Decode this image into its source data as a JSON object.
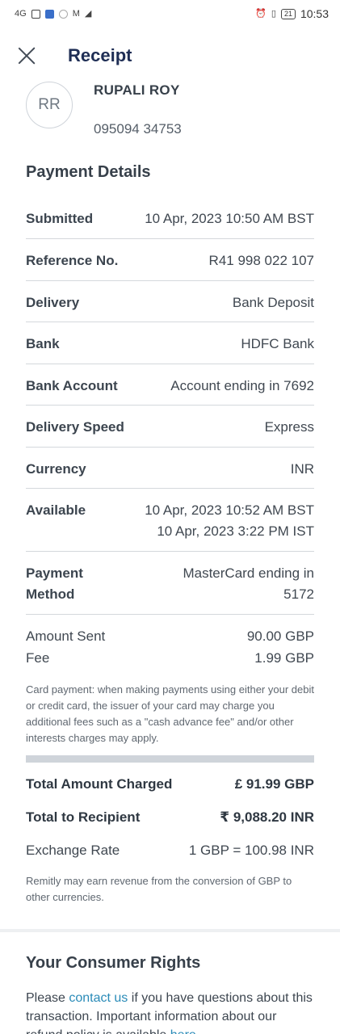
{
  "status_bar": {
    "network": "4G",
    "time": "10:53",
    "battery": "21"
  },
  "header": {
    "title": "Receipt"
  },
  "recipient": {
    "initials": "RR",
    "name": "RUPALI ROY",
    "phone": "095094 34753"
  },
  "payment_details": {
    "title": "Payment Details",
    "rows": [
      {
        "label": "Submitted",
        "value": [
          "10 Apr, 2023 10:50 AM BST"
        ]
      },
      {
        "label": "Reference No.",
        "value": [
          "R41 998 022 107"
        ]
      },
      {
        "label": "Delivery",
        "value": [
          "Bank Deposit"
        ]
      },
      {
        "label": "Bank",
        "value": [
          "HDFC Bank"
        ]
      },
      {
        "label": "Bank Account",
        "value": [
          "Account ending in 7692"
        ]
      },
      {
        "label": "Delivery Speed",
        "value": [
          "Express"
        ]
      },
      {
        "label": "Currency",
        "value": [
          "INR"
        ]
      },
      {
        "label": "Available",
        "value": [
          "10 Apr, 2023 10:52 AM BST",
          "10 Apr, 2023 3:22 PM IST"
        ]
      },
      {
        "label": [
          "Payment",
          "Method"
        ],
        "value": [
          "MasterCard ending in",
          "5172"
        ]
      }
    ]
  },
  "amounts": {
    "sent_label": "Amount Sent",
    "sent_value": "90.00 GBP",
    "fee_label": "Fee",
    "fee_value": "1.99 GBP",
    "card_note": "Card payment: when making payments using either your debit or credit card, the issuer of your card may charge you additional fees such as a \"cash advance fee\" and/or other interests charges may apply."
  },
  "totals": {
    "charged_label": "Total Amount Charged",
    "charged_value": "£ 91.99 GBP",
    "recipient_label": "Total to Recipient",
    "recipient_value": "₹ 9,088.20 INR",
    "rate_label": "Exchange Rate",
    "rate_value": "1 GBP = 100.98 INR",
    "revenue_note": "Remitly may earn revenue from the conversion of GBP to other currencies."
  },
  "consumer_rights": {
    "title": "Your Consumer Rights",
    "text_before": "Please ",
    "contact_link": "contact us",
    "text_middle": " if you have questions about this transaction. Important information about our refund policy is available ",
    "here_link": "here"
  }
}
